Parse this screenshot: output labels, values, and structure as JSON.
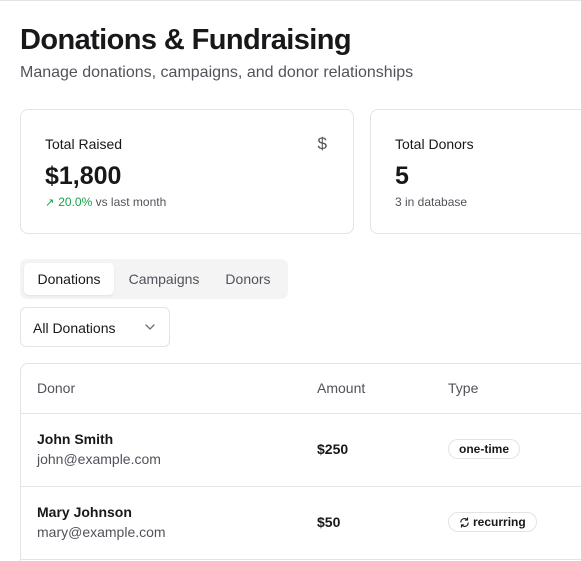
{
  "header": {
    "title": "Donations & Fundraising",
    "subtitle": "Manage donations, campaigns, and donor relationships"
  },
  "stats": [
    {
      "label": "Total Raised",
      "icon": "dollar-icon",
      "value": "$1,800",
      "trend": "20.0%",
      "sub": "vs last month"
    },
    {
      "label": "Total Donors",
      "value": "5",
      "sub": "3 in database"
    }
  ],
  "tabs": [
    {
      "label": "Donations",
      "active": true
    },
    {
      "label": "Campaigns",
      "active": false
    },
    {
      "label": "Donors",
      "active": false
    }
  ],
  "filter": {
    "selected": "All Donations"
  },
  "table": {
    "columns": [
      "Donor",
      "Amount",
      "Type"
    ],
    "rows": [
      {
        "name": "John Smith",
        "email": "john@example.com",
        "amount": "$250",
        "type": "one-time"
      },
      {
        "name": "Mary Johnson",
        "email": "mary@example.com",
        "amount": "$50",
        "type": "recurring",
        "type_icon": "refresh-icon"
      }
    ]
  },
  "colors": {
    "trend_up": "#16a34a",
    "border": "#e4e4e7",
    "muted_text": "#52525b",
    "tab_background": "#f4f4f5"
  }
}
